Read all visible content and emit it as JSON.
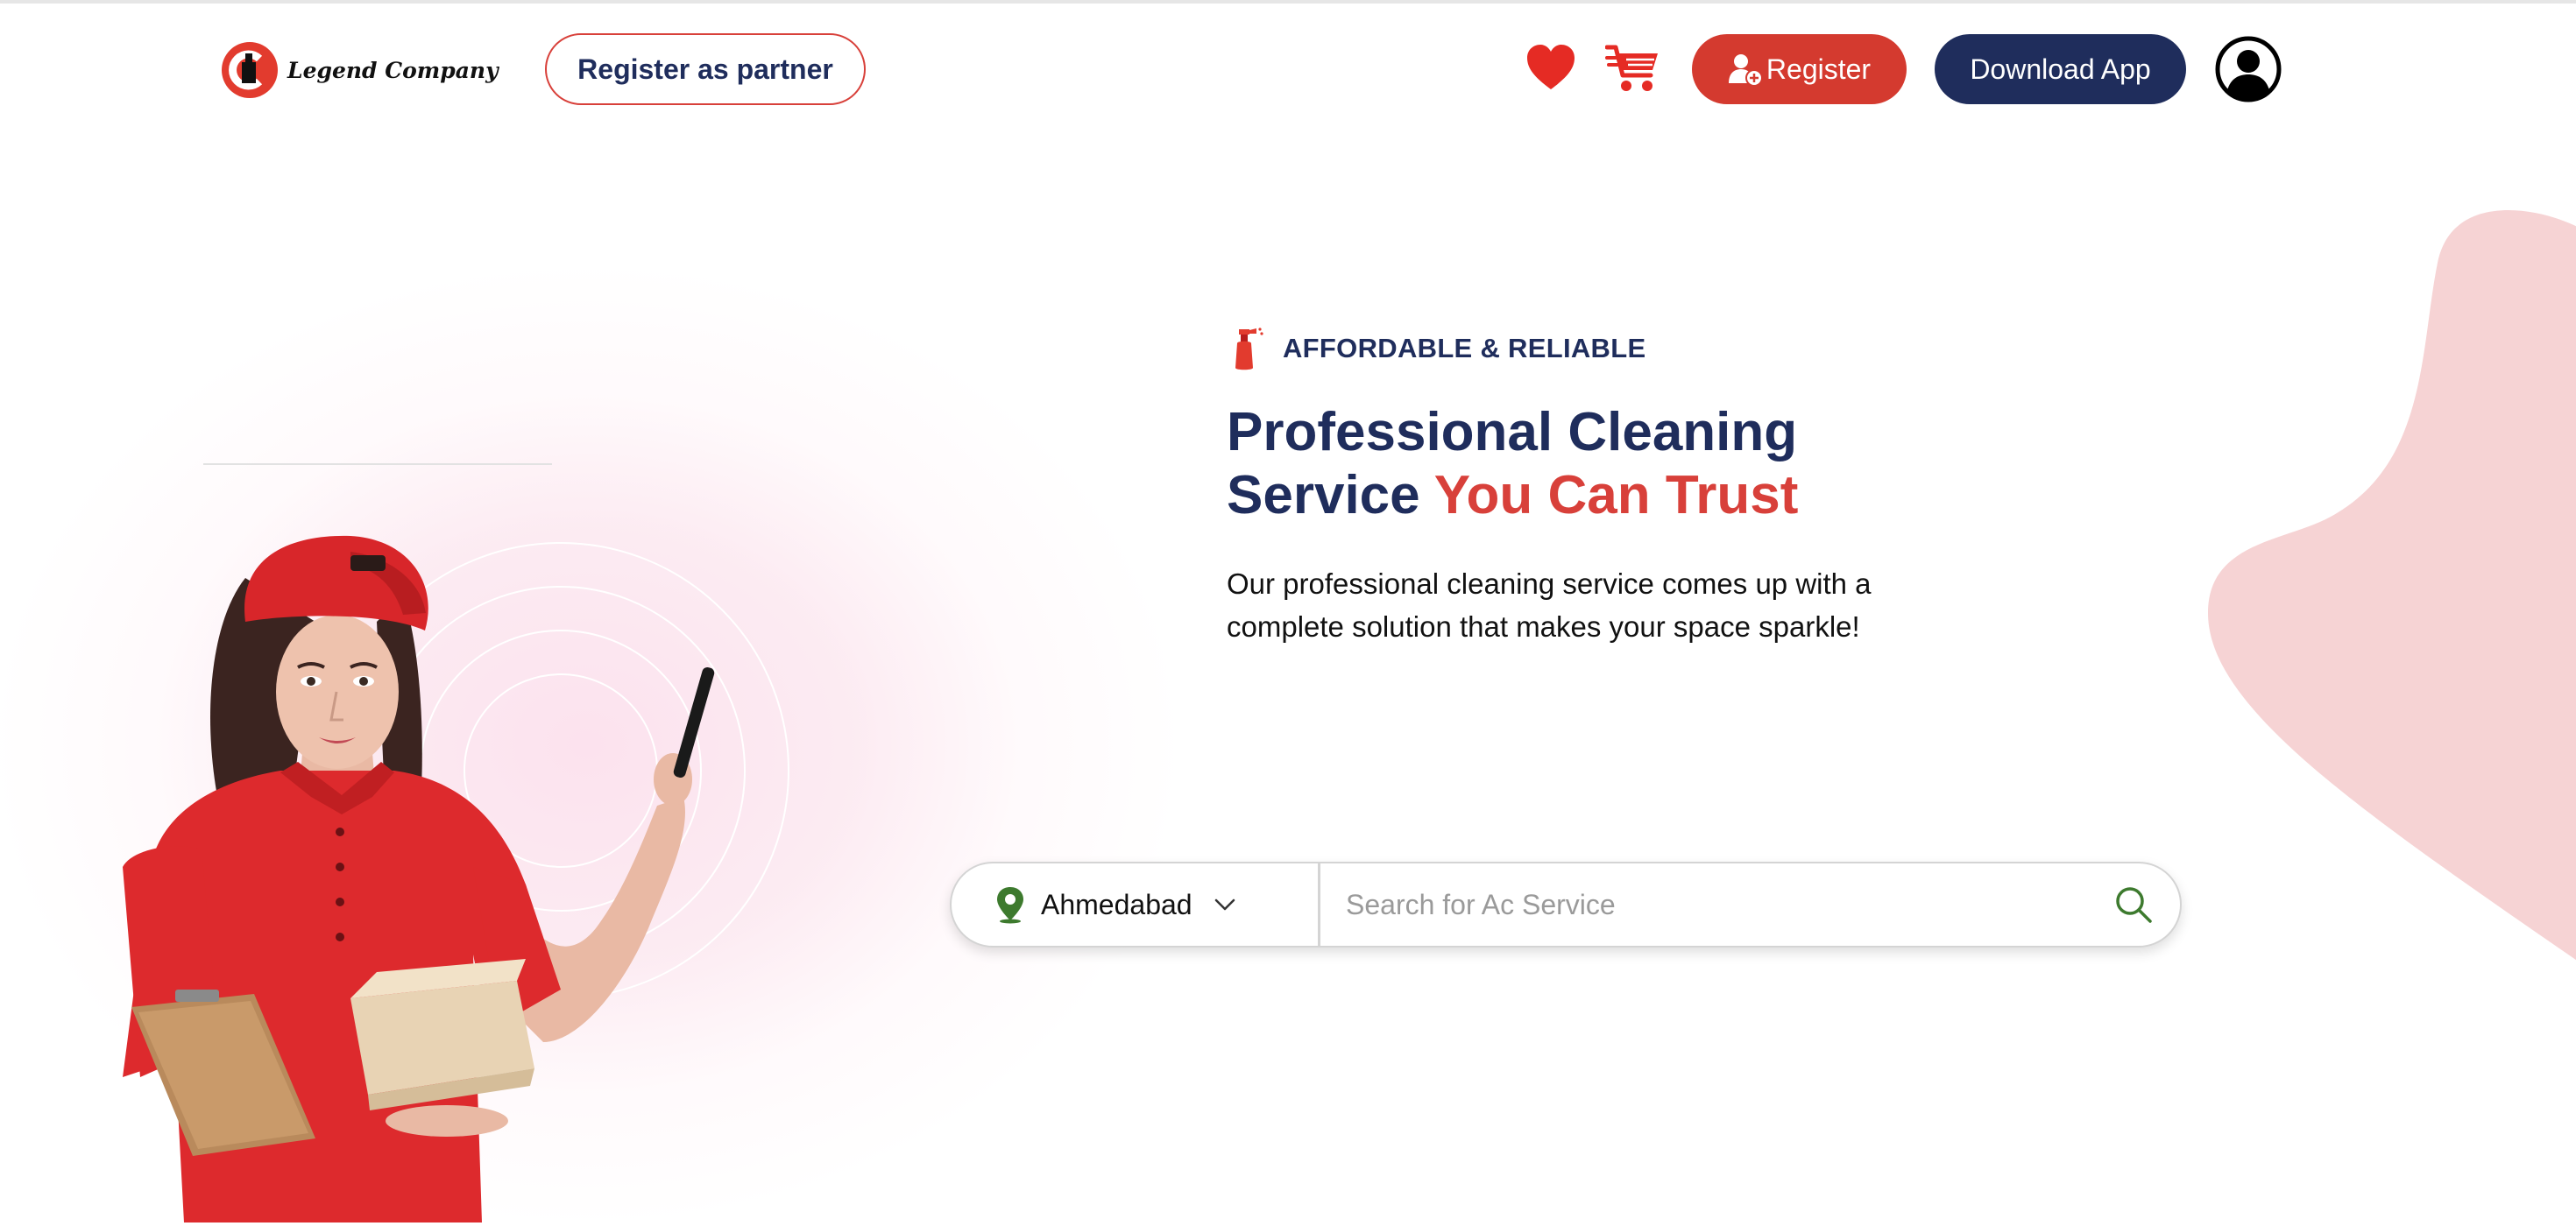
{
  "header": {
    "brand": "Legend Company",
    "partner_label": "Register as partner",
    "icons": [
      "heart-icon",
      "cart-icon",
      "user-add-icon",
      "account-icon"
    ],
    "register_label": "Register",
    "download_label": "Download App"
  },
  "hero": {
    "tagline": "AFFORDABLE & RELIABLE",
    "headline_line1": "Professional Cleaning",
    "headline_line2_plain": "Service",
    "headline_line2_accent": "You Can Trust",
    "description": "Our professional cleaning service comes up with a complete solution that makes your space sparkle!"
  },
  "search": {
    "city": "Ahmedabad",
    "placeholder": "Search for Ac Service",
    "value": ""
  },
  "colors": {
    "navy": "#1f2d5c",
    "brand_red": "#d8403a",
    "button_red": "#d43a2f",
    "location_green": "#3d7a2e",
    "blob_pink": "#f6d3d4"
  }
}
